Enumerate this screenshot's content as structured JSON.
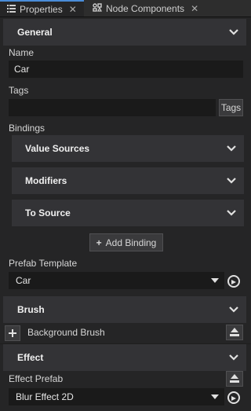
{
  "tabs": [
    {
      "label": "Properties",
      "active": true,
      "icon": "list-icon"
    },
    {
      "label": "Node Components",
      "active": false,
      "icon": "components-icon"
    }
  ],
  "general": {
    "header": "General",
    "name_label": "Name",
    "name_value": "Car",
    "tags_label": "Tags",
    "tags_value": "",
    "tags_button": "Tags",
    "bindings_label": "Bindings",
    "binding_sections": [
      "Value Sources",
      "Modifiers",
      "To Source"
    ],
    "add_binding": "Add Binding",
    "prefab_template_label": "Prefab Template",
    "prefab_template_value": "Car"
  },
  "brush": {
    "header": "Brush",
    "background_brush_label": "Background Brush"
  },
  "effect": {
    "header": "Effect",
    "effect_prefab_label": "Effect Prefab",
    "effect_prefab_value": "Blur Effect 2D"
  },
  "colors": {
    "background": "#252526",
    "header_bg": "#333336",
    "field_bg": "#1a1a1a",
    "active_tab_accent": "#4a8cd8"
  }
}
